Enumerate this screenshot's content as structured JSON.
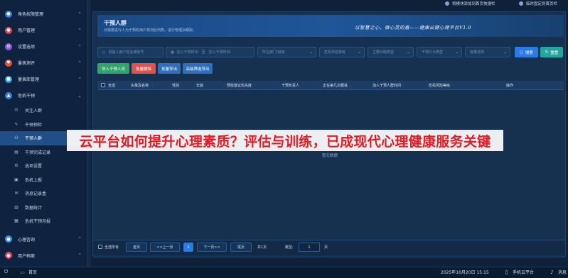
{
  "sidebar": {
    "items": [
      {
        "label": "角色权限管理",
        "icon": "role-icon",
        "color": "#3b82d6"
      },
      {
        "label": "用户管理",
        "icon": "user-icon",
        "color": "#e04a5b"
      },
      {
        "label": "设置选项",
        "icon": "settings-icon",
        "color": "#8d5be0"
      },
      {
        "label": "量表测评",
        "icon": "heart-icon",
        "color": "#e0563b"
      },
      {
        "label": "量表库管理",
        "icon": "library-icon",
        "color": "#3b9be0"
      },
      {
        "label": "危机干预",
        "icon": "crisis-icon",
        "color": "#3b82d6"
      }
    ],
    "sub_items": [
      {
        "label": "关注人群",
        "icon": "people-icon"
      },
      {
        "label": "干预预检",
        "icon": "check-icon"
      },
      {
        "label": "干预人群",
        "icon": "group-icon"
      },
      {
        "label": "干预完成记录",
        "icon": "record-icon"
      },
      {
        "label": "选项设置",
        "icon": "option-icon"
      },
      {
        "label": "危机上报",
        "icon": "report-icon"
      },
      {
        "label": "消息记录盒",
        "icon": "message-icon"
      },
      {
        "label": "数据统计",
        "icon": "stats-icon"
      },
      {
        "label": "危机干预月报",
        "icon": "monthly-icon"
      }
    ],
    "bottom_items": [
      {
        "label": "心理咨询",
        "icon": "consult-icon",
        "color": "#3b9be0"
      },
      {
        "label": "用户档案",
        "icon": "archive-icon",
        "color": "#e04a5b"
      }
    ]
  },
  "header": {
    "link_add_shortcut": "将模块添加到首页快捷栏",
    "link_pin": "临时固定到首页栏"
  },
  "banner": {
    "title": "干预人群",
    "desc": "对需要进行人为干预的用户将列此列表。进行管理及跟踪。",
    "slogan": "以智慧之心，做心灵的盾——健康云键心理平台V1.0"
  },
  "filters": {
    "name_placeholder": "请输入用户姓名或账号",
    "start_placeholder": "加入干预时间",
    "to": "至",
    "end_placeholder": "加入干预时间",
    "dept_placeholder": "所在部门/班级",
    "risk_placeholder": "危机风险等级",
    "issue_placeholder": "主要问题类型",
    "behavior_placeholder": "干预行为类型",
    "status_placeholder": "批量选择",
    "search_label": "搜索",
    "reset_label": "重置"
  },
  "actions": {
    "import": "导入干预人员",
    "batch_delete": "批量删除",
    "batch_export": "批量导出",
    "advanced_export": "高级筛选导出"
  },
  "table": {
    "columns": [
      "全选",
      "头像及名称",
      "性别",
      "年龄",
      "预检建议优先度",
      "干预负责人",
      "正在第几次跟进",
      "加入干预人群时间",
      "危机风险等级",
      "操作"
    ],
    "empty_text": "暂无数据"
  },
  "overlay": {
    "headline": "云平台如何提升心理素质？评估与训练，已成现代心理健康服务关键"
  },
  "pagination": {
    "select_all": "全选所有",
    "first": "首页",
    "prev": "<<上一页",
    "current": "1",
    "next": "下一页>>",
    "last": "尾页",
    "total": "共1页",
    "jump_label": "跳至:",
    "jump_value": "1",
    "page_unit": "页"
  },
  "taskbar": {
    "home": "首页",
    "datetime": "2025年10月20日 15:15",
    "mobile": "手机云平台",
    "messages": "消息"
  },
  "colors": {
    "accent": "#2d7be0",
    "import_green": "#2fa56a",
    "delete_red": "#d9534f",
    "export_blue": "#2d6fb8",
    "search_blue": "#2d7be0",
    "reset_teal": "#23a6a0"
  }
}
